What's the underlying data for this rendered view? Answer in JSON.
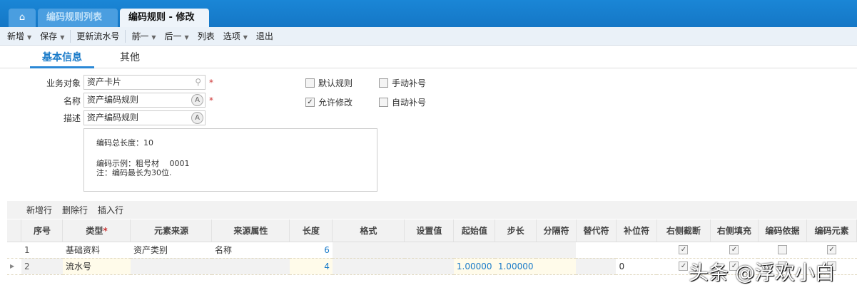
{
  "tabs": {
    "home_icon": "home-icon",
    "list": "编码规则列表",
    "active": "编码规则 - 修改",
    "close": "✕"
  },
  "toolbar": {
    "add": "新增",
    "save": "保存",
    "update_serial": "更新流水号",
    "prev": "前一",
    "next": "后一",
    "list": "列表",
    "options": "选项",
    "exit": "退出"
  },
  "subtabs": {
    "basic": "基本信息",
    "other": "其他"
  },
  "form": {
    "biz_object": {
      "label": "业务对象",
      "value": "资产卡片"
    },
    "name": {
      "label": "名称",
      "value": "资产编码规则"
    },
    "desc": {
      "label": "描述",
      "value": "资产编码规则"
    },
    "required": "*",
    "checkboxes": [
      {
        "label": "默认规则",
        "checked": false
      },
      {
        "label": "手动补号",
        "checked": false
      },
      {
        "label": "允许修改",
        "checked": true
      },
      {
        "label": "自动补号",
        "checked": false
      }
    ],
    "info": {
      "total_length": "编码总长度：10",
      "example": "编码示例：粗号材　 0001",
      "note": "注：编码最长为30位."
    }
  },
  "grid": {
    "actions": [
      "新增行",
      "删除行",
      "插入行"
    ],
    "columns": [
      "序号",
      "类型",
      "元素来源",
      "来源属性",
      "长度",
      "格式",
      "设置值",
      "起始值",
      "步长",
      "分隔符",
      "替代符",
      "补位符",
      "右侧截断",
      "右侧填充",
      "编码依据",
      "编码元素"
    ],
    "rows": [
      {
        "seq": "1",
        "type": "基础资料",
        "source": "资产类别",
        "attr": "名称",
        "length": "6",
        "format": "",
        "setval": "",
        "start": "",
        "step": "",
        "sep": "",
        "sub": "",
        "pad": "",
        "trunc": true,
        "fill": true,
        "basis": false,
        "elem": true
      },
      {
        "seq": "2",
        "type": "流水号",
        "source": "",
        "attr": "",
        "length": "4",
        "format": "",
        "setval": "",
        "start": "1.00000",
        "step": "1.00000",
        "sep": "",
        "sub": "",
        "pad": "0",
        "trunc": true,
        "fill": true,
        "basis": false,
        "elem": true
      }
    ]
  },
  "watermark": "头条 @浮欢小白"
}
